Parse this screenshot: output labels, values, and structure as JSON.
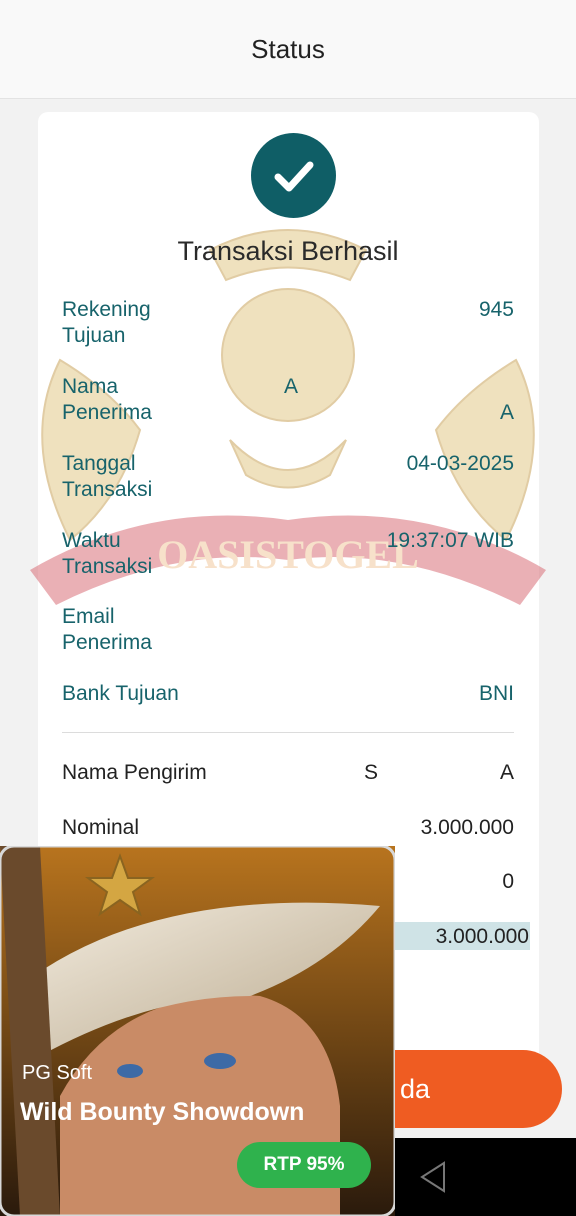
{
  "header": {
    "title": "Status"
  },
  "status": {
    "title": "Transaksi Berhasil"
  },
  "details": [
    {
      "label": "Rekening Tujuan",
      "value": "945"
    },
    {
      "label": "Nama Penerima",
      "mid": "A",
      "value": "A"
    },
    {
      "label": "Tanggal Transaksi",
      "value": "04-03-2025"
    },
    {
      "label": "Waktu Transaksi",
      "value": "19:37:07 WIB"
    },
    {
      "label": "Email Penerima",
      "value": ""
    },
    {
      "label": "Bank Tujuan",
      "value": "BNI"
    }
  ],
  "summary": [
    {
      "label": "Nama Pengirim",
      "mid": "S",
      "value": "A"
    },
    {
      "label": "Nominal",
      "value": "3.000.000"
    },
    {
      "label": "",
      "value": "0"
    },
    {
      "label": "",
      "value": "3.000.000"
    }
  ],
  "watermark": {
    "text": "OASISTOGEL"
  },
  "button": {
    "label": "da"
  },
  "ad": {
    "provider": "PG Soft",
    "title": "Wild Bounty Showdown",
    "rtp": "RTP 95%"
  },
  "colors": {
    "accent": "#0f5e66",
    "button": "#ef5c22",
    "label": "#17636b"
  }
}
